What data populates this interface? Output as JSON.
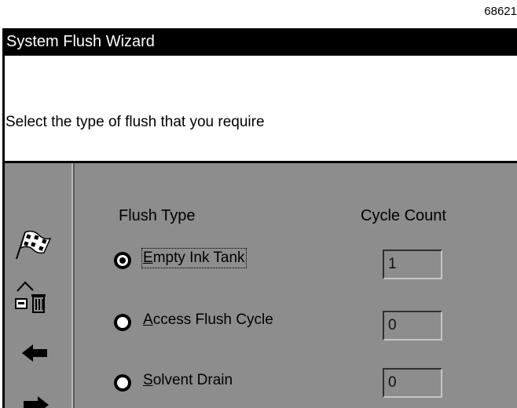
{
  "figure_id": "68621",
  "window": {
    "title": "System Flush Wizard"
  },
  "instruction": "Select the type of flush that you require",
  "columns": {
    "flush_type": "Flush Type",
    "cycle_count": "Cycle Count"
  },
  "options": [
    {
      "mnemonic": "E",
      "rest": "mpty Ink Tank",
      "selected": true,
      "cycle_count": "1"
    },
    {
      "mnemonic": "A",
      "rest": "ccess Flush Cycle",
      "selected": false,
      "cycle_count": "0"
    },
    {
      "mnemonic": "S",
      "rest": "olvent Drain",
      "selected": false,
      "cycle_count": "0"
    }
  ],
  "sidebar_icons": [
    "checkered-flag-icon",
    "trash-icon",
    "back-arrow-icon",
    "next-arrow-icon"
  ],
  "colors": {
    "titlebar": "#000000",
    "panel": "#8d8d8d",
    "text": "#000000"
  }
}
